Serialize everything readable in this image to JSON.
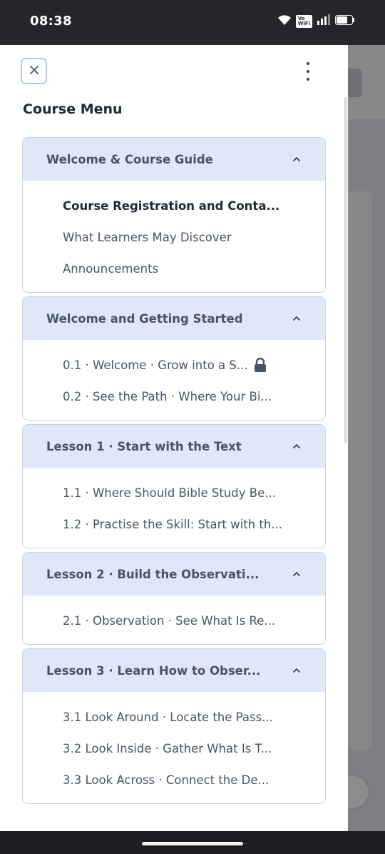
{
  "status_bar": {
    "time": "08:38",
    "vowifi_top": "Vo",
    "vowifi_bottom": "WiFi"
  },
  "drawer": {
    "title": "Course Menu",
    "sections": [
      {
        "title": "Welcome & Course Guide",
        "items": [
          {
            "label": "Course Registration and Conta...",
            "bold": true
          },
          {
            "label": "What Learners May Discover"
          },
          {
            "label": "Announcements"
          }
        ]
      },
      {
        "title": "Welcome and Getting Started",
        "items": [
          {
            "label": "0.1 · Welcome · Grow into a S...",
            "locked": true
          },
          {
            "label": "0.2 · See the Path · Where Your Bi..."
          }
        ]
      },
      {
        "title": "Lesson 1 · Start with the Text",
        "items": [
          {
            "label": "1.1 · Where Should Bible Study Be..."
          },
          {
            "label": "1.2 · Practise the Skill: Start with th..."
          }
        ]
      },
      {
        "title": "Lesson 2 · Build the Observati...",
        "items": [
          {
            "label": "2.1 · Observation · See What Is Re..."
          }
        ]
      },
      {
        "title": "Lesson 3 · Learn How to Obser...",
        "items": [
          {
            "label": "3.1 Look Around · Locate the Pass..."
          },
          {
            "label": "3.2 Look Inside · Gather What Is T..."
          },
          {
            "label": "3.3 Look Across · Connect the De..."
          }
        ]
      }
    ]
  },
  "colors": {
    "header_bg": "#dfe7f8",
    "border": "#c7d3ea",
    "title_text": "#1f2937",
    "item_text": "#4b5563"
  }
}
